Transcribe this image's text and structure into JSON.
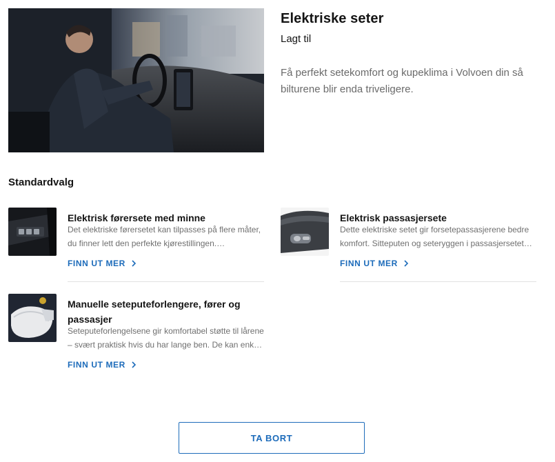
{
  "hero": {
    "title": "Elektriske seter",
    "status": "Lagt til",
    "description": "Få perfekt setekomfort og kupeklima i Volvoen din så bilturene blir enda triveligere."
  },
  "section": {
    "title": "Standardvalg"
  },
  "options": [
    {
      "name": "Elektrisk førersete med minne",
      "description": "Det elektriske førersetet kan tilpasses på flere måter, du finner lett den perfekte kjørestillingen. Innstillingene kan lagres i minnet.",
      "link": "FINN UT MER"
    },
    {
      "name": "Elektrisk passasjersete",
      "description": "Dette elektriske setet gir forsetepassasjerene bedre komfort. Sitteputen og seteryggen i passasjersetet kan justeres elektrisk.",
      "link": "FINN UT MER"
    },
    {
      "name": "Manuelle seteputeforlengere, fører og passasjer",
      "description": "Seteputeforlengelsene gir komfortabel støtte til lårene – svært praktisk hvis du har lange ben. De kan enkelt justeres manuelt.",
      "link": "FINN UT MER"
    }
  ],
  "actions": {
    "remove": "TA BORT"
  },
  "colors": {
    "accent": "#1c6bba",
    "text": "#141414",
    "muted": "#6f6f6f"
  }
}
